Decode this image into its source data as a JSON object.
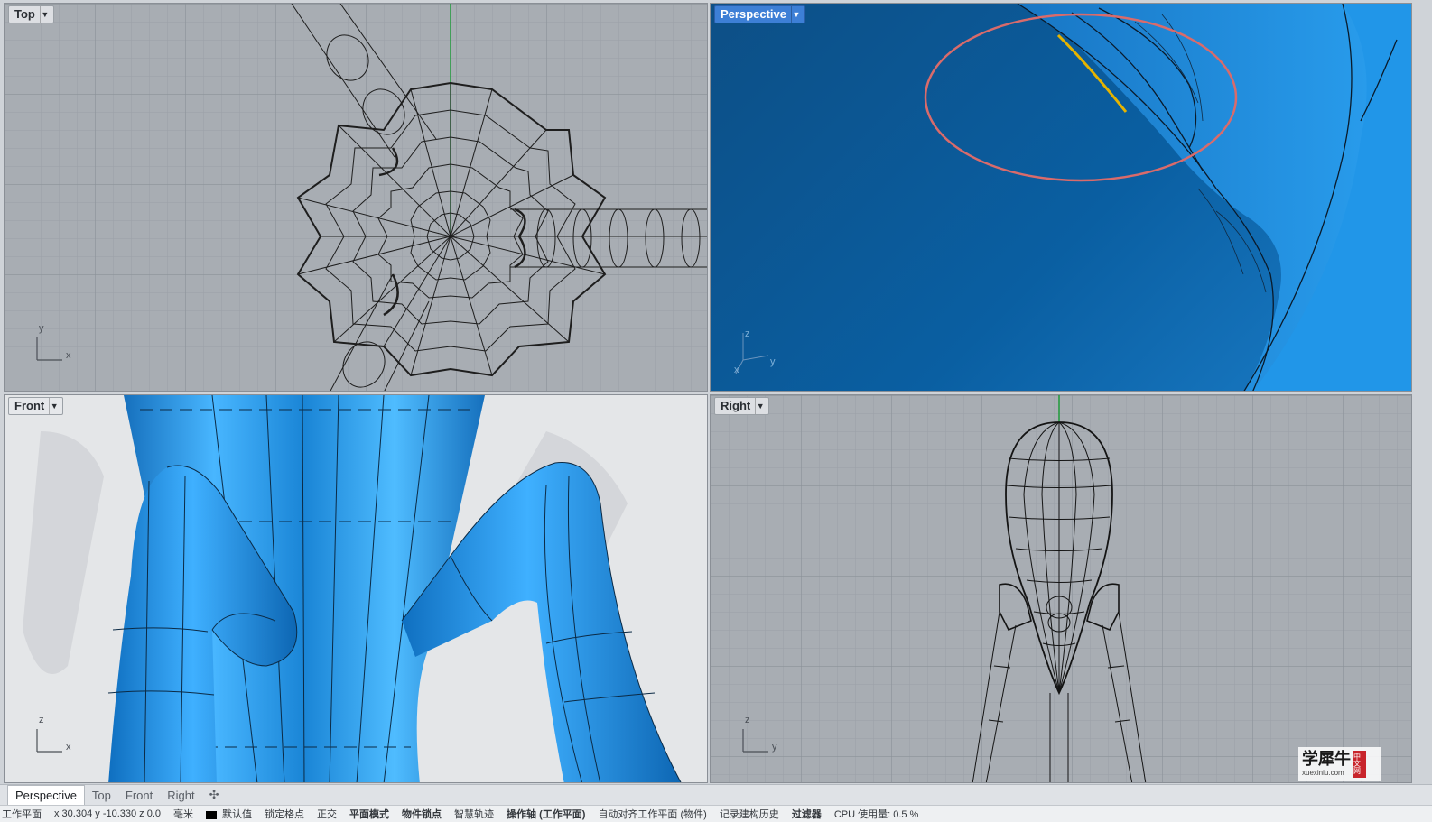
{
  "viewports": {
    "top": {
      "title": "Top",
      "axis_x": "x",
      "axis_y": "y"
    },
    "perspective": {
      "title": "Perspective",
      "axis_x": "x",
      "axis_y": "y",
      "axis_z": "z"
    },
    "front": {
      "title": "Front",
      "axis_x": "x",
      "axis_z": "z"
    },
    "right": {
      "title": "Right",
      "axis_y": "y",
      "axis_z": "z"
    }
  },
  "tabs": [
    "Perspective",
    "Top",
    "Front",
    "Right"
  ],
  "tabs_active": "Perspective",
  "add_tab_icon": "plus-icon",
  "statusbar": {
    "plane": "工作平面",
    "coords": "x 30.304  y -10.330  z 0.0",
    "units": "毫米",
    "layer": "默认值",
    "osnap": "锁定格点",
    "ortho": "正交",
    "planar": "平面模式",
    "object_snap": "物件锁点",
    "smart_track": "智慧轨迹",
    "gumball": "操作轴 (工作平面)",
    "auto_align": "自动对齐工作平面 (物件)",
    "history": "记录建构历史",
    "filter": "过滤器",
    "cpu": "CPU 使用量: 0.5 %"
  },
  "watermark": {
    "main": "学犀牛",
    "sub": "xuexiniu.com",
    "badge": "中文网"
  },
  "colors": {
    "model_blue": "#1e8ee0",
    "highlight_circle": "#d96b6b",
    "axis_green": "#1f9a3a"
  }
}
